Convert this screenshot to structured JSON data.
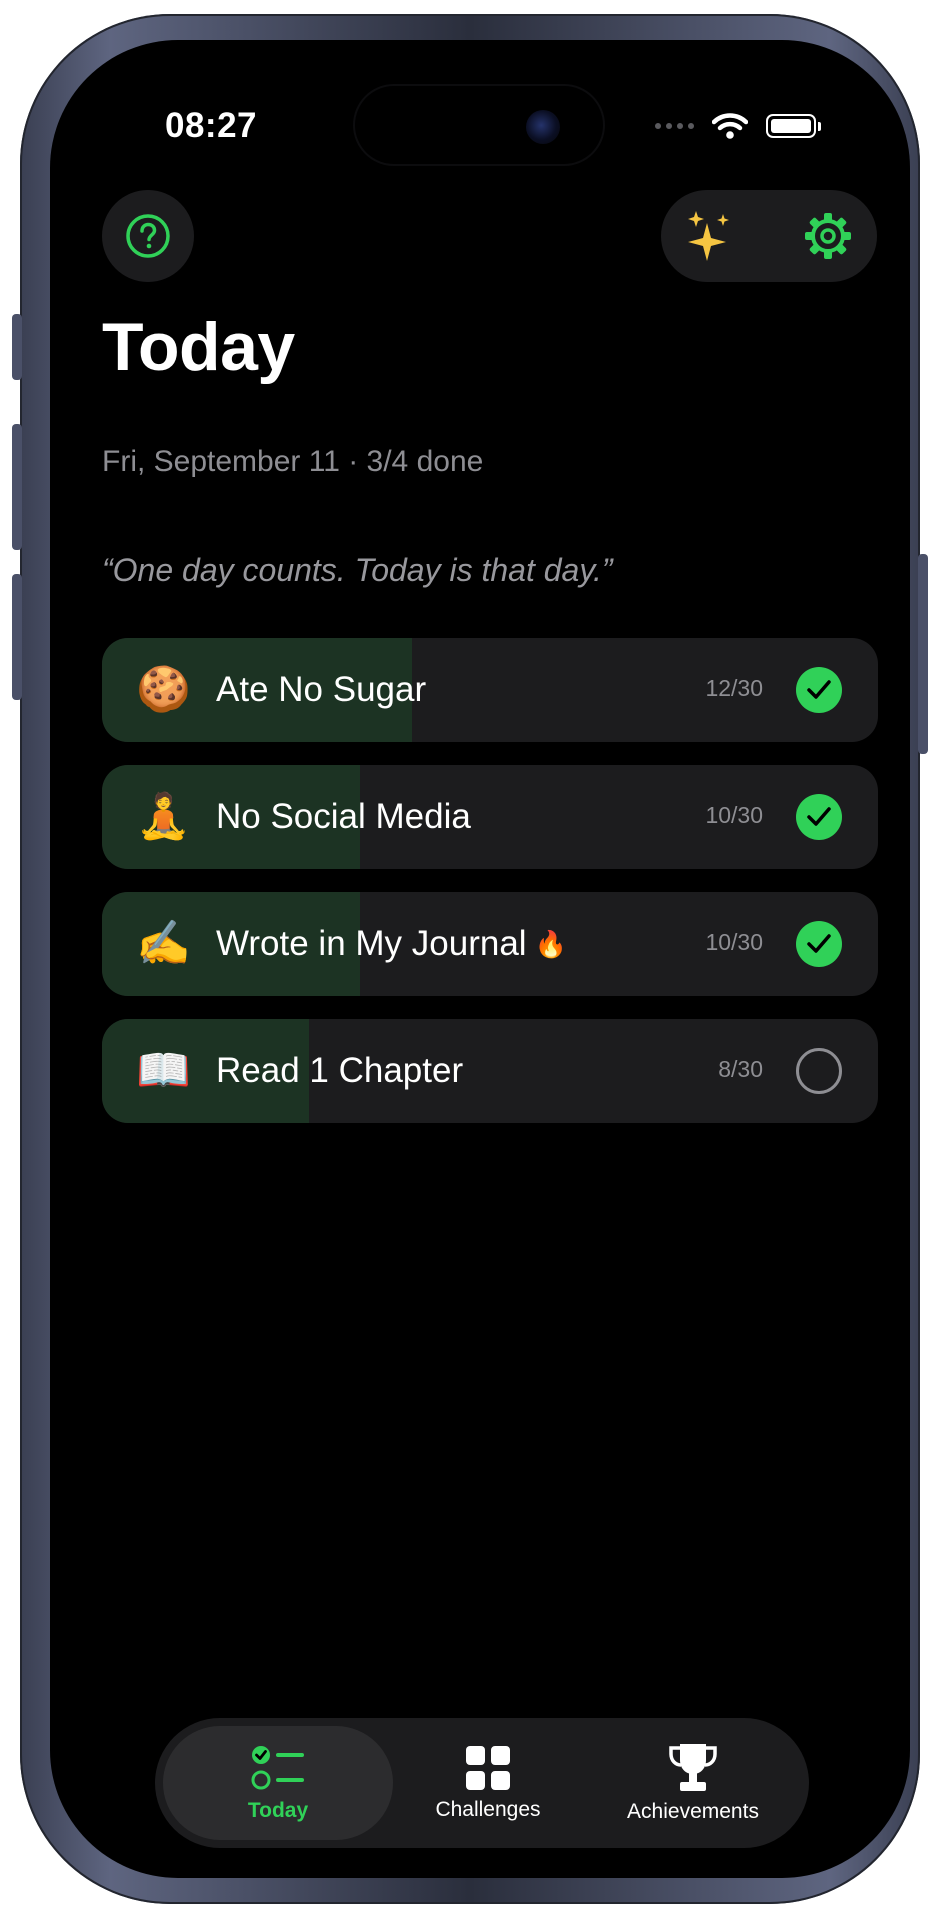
{
  "status_bar": {
    "time": "08:27"
  },
  "header": {
    "title": "Today",
    "subtitle": "Fri, September 11 · 3/4 done",
    "quote": "“One day counts. Today is that day.”"
  },
  "colors": {
    "accent": "#30d158",
    "sparkle": "#f5c542",
    "progress_fill": "#1c3323",
    "card": "#1c1c1e"
  },
  "habits": [
    {
      "emoji": "🍪",
      "name": "Ate No Sugar",
      "count": "12/30",
      "progress": 0.4,
      "done": true,
      "streak": ""
    },
    {
      "emoji": "🧘",
      "name": "No Social Media",
      "count": "10/30",
      "progress": 0.333,
      "done": true,
      "streak": ""
    },
    {
      "emoji": "✍️",
      "name": "Wrote in My Journal",
      "count": "10/30",
      "progress": 0.333,
      "done": true,
      "streak": "🔥"
    },
    {
      "emoji": "📖",
      "name": "Read 1 Chapter",
      "count": "8/30",
      "progress": 0.267,
      "done": false,
      "streak": ""
    }
  ],
  "tabs": [
    {
      "label": "Today",
      "icon": "checklist-icon",
      "active": true
    },
    {
      "label": "Challenges",
      "icon": "grid-icon",
      "active": false
    },
    {
      "label": "Achievements",
      "icon": "trophy-icon",
      "active": false
    }
  ]
}
